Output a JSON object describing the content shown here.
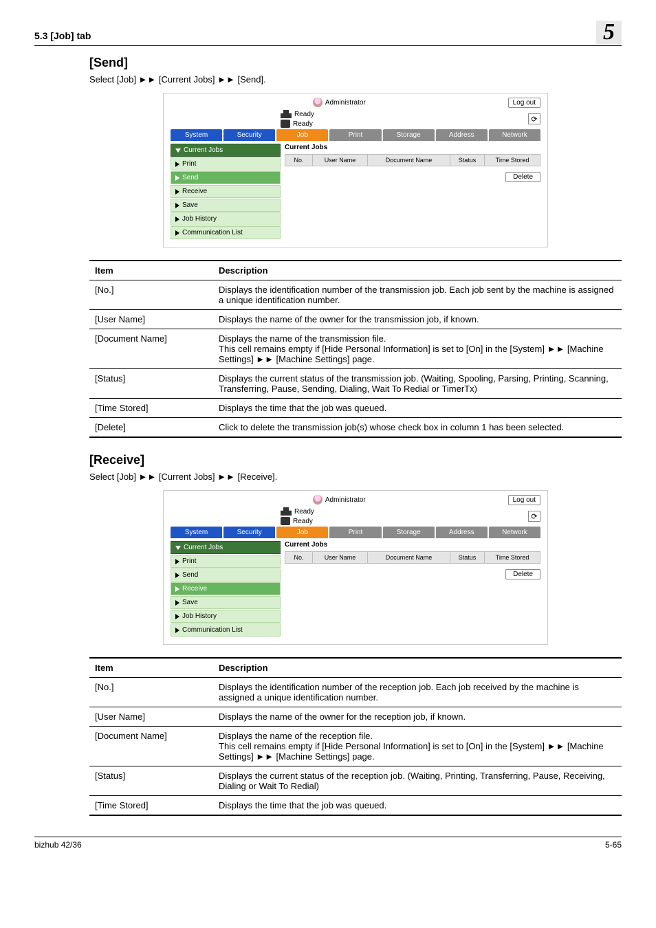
{
  "header": {
    "left": "5.3      [Job] tab",
    "right": "5"
  },
  "send": {
    "heading": "[Send]",
    "instruction": "Select [Job] ►► [Current Jobs] ►► [Send]."
  },
  "receive": {
    "heading": "[Receive]",
    "instruction": "Select [Job] ►► [Current Jobs] ►► [Receive]."
  },
  "screenshot": {
    "admin": "Administrator",
    "logout": "Log out",
    "ready": "Ready",
    "tabs": [
      "System",
      "Security",
      "Job",
      "Print",
      "Storage",
      "Address",
      "Network"
    ],
    "side": {
      "current": "Current Jobs",
      "print": "Print",
      "send": "Send",
      "receive": "Receive",
      "save": "Save",
      "history": "Job History",
      "comm": "Communication List"
    },
    "main_title": "Current Jobs",
    "columns": [
      "No.",
      "User Name",
      "Document Name",
      "Status",
      "Time Stored"
    ],
    "delete": "Delete"
  },
  "table_headers": {
    "item": "Item",
    "desc": "Description"
  },
  "send_table": [
    {
      "item": "[No.]",
      "desc": "Displays the identification number of the transmission job. Each job sent by the machine is assigned a unique identification number."
    },
    {
      "item": "[User Name]",
      "desc": "Displays the name of the owner for the transmission job, if known."
    },
    {
      "item": "[Document Name]",
      "desc": "Displays the name of the transmission file.\nThis cell remains empty if [Hide Personal Information] is set to [On] in the [System] ►► [Machine Settings] ►► [Machine Settings] page."
    },
    {
      "item": "[Status]",
      "desc": "Displays the current status of the transmission job. (Waiting, Spooling, Parsing, Printing, Scanning, Transferring, Pause, Sending, Dialing, Wait To Redial or TimerTx)"
    },
    {
      "item": "[Time Stored]",
      "desc": "Displays the time that the job was queued."
    },
    {
      "item": "[Delete]",
      "desc": "Click to delete the transmission job(s) whose check box in column 1 has been selected."
    }
  ],
  "receive_table": [
    {
      "item": "[No.]",
      "desc": "Displays the identification number of the reception job. Each job received by the machine is assigned a unique identification number."
    },
    {
      "item": "[User Name]",
      "desc": "Displays the name of the owner for the reception job, if known."
    },
    {
      "item": "[Document Name]",
      "desc": "Displays the name of the reception file.\nThis cell remains empty if [Hide Personal Information] is set to [On] in the [System] ►► [Machine Settings] ►► [Machine Settings] page."
    },
    {
      "item": "[Status]",
      "desc": "Displays the current status of the reception job. (Waiting, Printing, Transferring, Pause, Receiving, Dialing or Wait To Redial)"
    },
    {
      "item": "[Time Stored]",
      "desc": "Displays the time that the job was queued."
    }
  ],
  "footer": {
    "left": "bizhub 42/36",
    "right": "5-65"
  }
}
